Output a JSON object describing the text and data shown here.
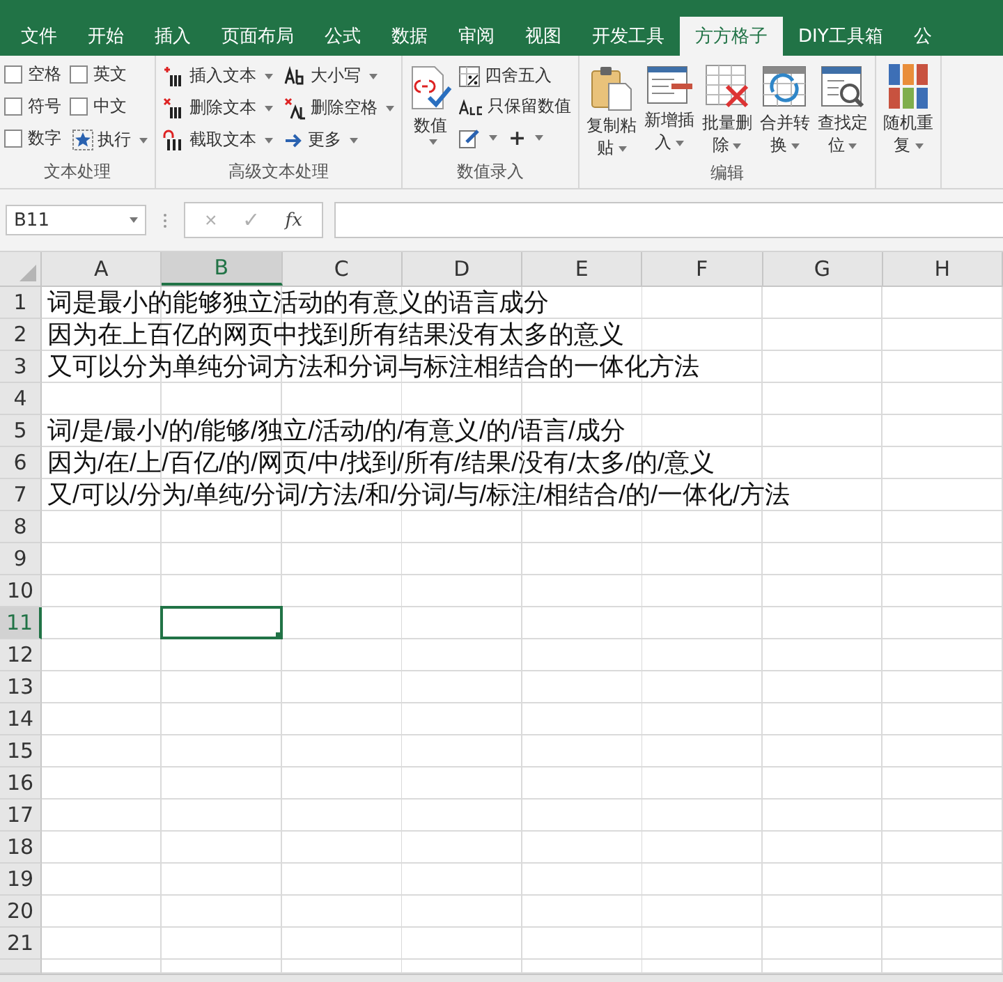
{
  "tabs": [
    {
      "label": "文件",
      "selected": false
    },
    {
      "label": "开始",
      "selected": false
    },
    {
      "label": "插入",
      "selected": false
    },
    {
      "label": "页面布局",
      "selected": false
    },
    {
      "label": "公式",
      "selected": false
    },
    {
      "label": "数据",
      "selected": false
    },
    {
      "label": "审阅",
      "selected": false
    },
    {
      "label": "视图",
      "selected": false
    },
    {
      "label": "开发工具",
      "selected": false
    },
    {
      "label": "方方格子",
      "selected": true
    },
    {
      "label": "DIY工具箱",
      "selected": false
    },
    {
      "label": "公",
      "selected": false
    }
  ],
  "ribbon": {
    "groups": [
      {
        "label": "文本处理",
        "kind": "checkboxes",
        "items": [
          {
            "kind": "checkbox",
            "label": "空格",
            "checked": false
          },
          {
            "kind": "checkbox",
            "label": "英文",
            "checked": false
          },
          {
            "kind": "checkbox",
            "label": "符号",
            "checked": false
          },
          {
            "kind": "checkbox",
            "label": "中文",
            "checked": false
          },
          {
            "kind": "checkbox",
            "label": "数字",
            "checked": false
          },
          {
            "kind": "menu",
            "label": "执行"
          }
        ]
      },
      {
        "label": "高级文本处理",
        "kind": "small",
        "items": [
          {
            "label": "插入文本"
          },
          {
            "label": "大小写"
          },
          {
            "label": "删除文本"
          },
          {
            "label": "删除空格"
          },
          {
            "label": "截取文本"
          },
          {
            "label": "更多"
          }
        ]
      },
      {
        "label": "数值录入",
        "kind": "mixed",
        "items": [
          {
            "kind": "large",
            "label": "数值"
          },
          {
            "kind": "small",
            "label": "四舍五入"
          },
          {
            "kind": "small",
            "label": "只保留数值"
          },
          {
            "kind": "tools",
            "label": "+"
          }
        ]
      },
      {
        "label": "编辑",
        "kind": "large",
        "items": [
          {
            "label": "复制粘贴"
          },
          {
            "label": "新增插入"
          },
          {
            "label": "批量删除"
          },
          {
            "label": "合并转换"
          },
          {
            "label": "查找定位"
          }
        ]
      },
      {
        "kind": "large",
        "items": [
          {
            "label": "随机重复"
          }
        ]
      }
    ]
  },
  "formula_bar": {
    "name_box": "B11",
    "cancel": "×",
    "enter": "✓",
    "fx": "fx"
  },
  "columns": [
    {
      "label": "A",
      "selected": false
    },
    {
      "label": "B",
      "selected": true
    },
    {
      "label": "C",
      "selected": false
    },
    {
      "label": "D",
      "selected": false
    },
    {
      "label": "E",
      "selected": false
    },
    {
      "label": "F",
      "selected": false
    },
    {
      "label": "G",
      "selected": false
    },
    {
      "label": "H",
      "selected": false
    }
  ],
  "rows": [
    {
      "number": "1",
      "selected": false,
      "text": "词是最小的能够独立活动的有意义的语言成分"
    },
    {
      "number": "2",
      "selected": false,
      "text": "因为在上百亿的网页中找到所有结果没有太多的意义"
    },
    {
      "number": "3",
      "selected": false,
      "text": "又可以分为单纯分词方法和分词与标注相结合的一体化方法"
    },
    {
      "number": "4",
      "selected": false
    },
    {
      "number": "5",
      "selected": false,
      "text": "词/是/最小/的/能够/独立/活动/的/有意义/的/语言/成分"
    },
    {
      "number": "6",
      "selected": false,
      "text": "因为/在/上/百亿/的/网页/中/找到/所有/结果/没有/太多/的/意义"
    },
    {
      "number": "7",
      "selected": false,
      "text": "又/可以/分为/单纯/分词/方法/和/分词/与/标注/相结合/的/一体化/方法"
    },
    {
      "number": "8",
      "selected": false
    },
    {
      "number": "9",
      "selected": false
    },
    {
      "number": "10",
      "selected": false
    },
    {
      "number": "11",
      "selected": true
    },
    {
      "number": "12",
      "selected": false
    },
    {
      "number": "13",
      "selected": false
    },
    {
      "number": "14",
      "selected": false
    },
    {
      "number": "15",
      "selected": false
    },
    {
      "number": "16",
      "selected": false
    },
    {
      "number": "17",
      "selected": false
    },
    {
      "number": "18",
      "selected": false
    },
    {
      "number": "19",
      "selected": false
    },
    {
      "number": "20",
      "selected": false
    },
    {
      "number": "21",
      "selected": false
    }
  ]
}
